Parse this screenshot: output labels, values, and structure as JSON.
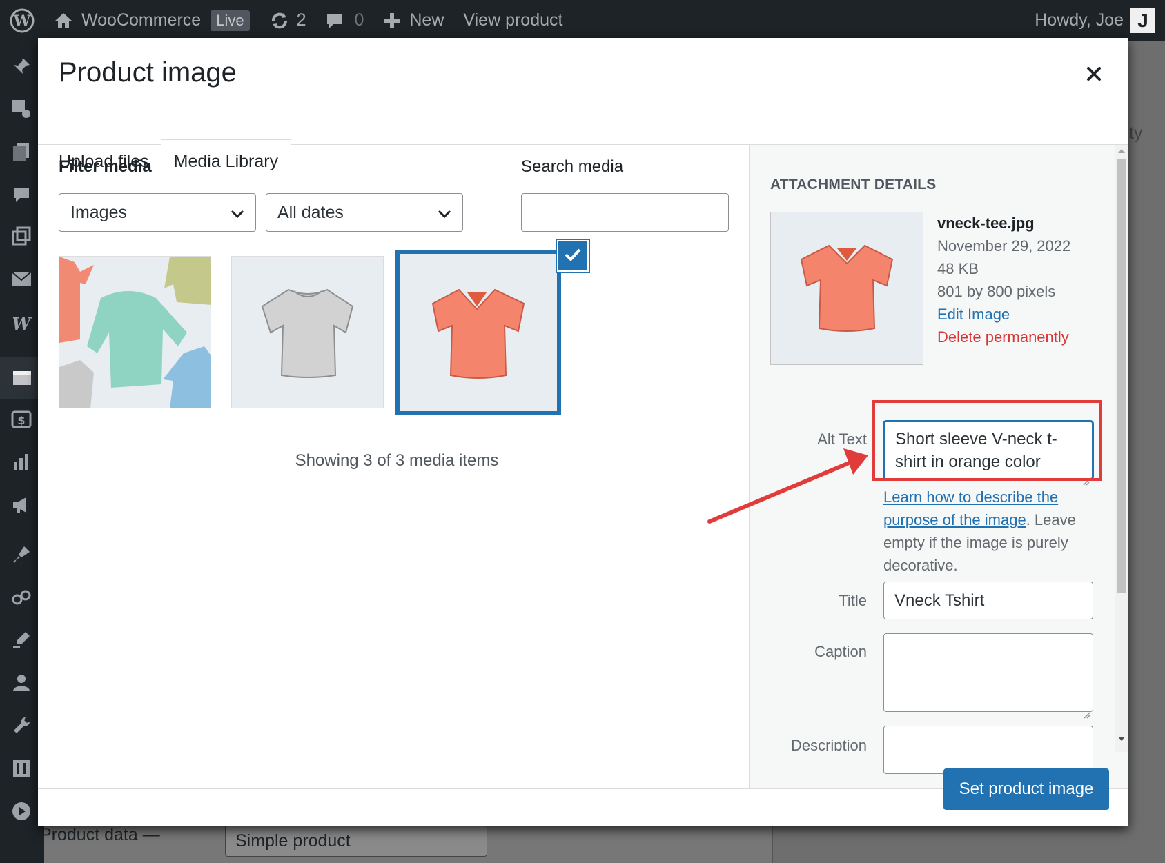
{
  "admin_bar": {
    "site_name": "WooCommerce",
    "live_badge": "Live",
    "updates_count": "2",
    "comments_count": "0",
    "new_label": "New",
    "view_product_label": "View product",
    "greeting": "Howdy, Joe",
    "avatar_letter": "J"
  },
  "background": {
    "product_data_label": "Product data —",
    "product_type_value": "Simple product",
    "right_text": "vity"
  },
  "modal": {
    "title": "Product image",
    "tabs": [
      {
        "label": "Upload files",
        "active": false
      },
      {
        "label": "Media Library",
        "active": true
      }
    ],
    "filter_label": "Filter media",
    "type_filter_value": "Images",
    "date_filter_value": "All dates",
    "search_label": "Search media",
    "search_value": "",
    "media_items": [
      {
        "name": "long-sleeve-tees",
        "selected": false
      },
      {
        "name": "gray-tshirt",
        "selected": false
      },
      {
        "name": "vneck-tee",
        "selected": true
      }
    ],
    "count_text": "Showing 3 of 3 media items",
    "primary_button": "Set product image"
  },
  "attachment": {
    "heading": "ATTACHMENT DETAILS",
    "filename": "vneck-tee.jpg",
    "date": "November 29, 2022",
    "size": "48 KB",
    "dimensions": "801 by 800 pixels",
    "edit_link": "Edit Image",
    "delete_link": "Delete permanently",
    "alt_label": "Alt Text",
    "alt_value": "Short sleeve V-neck t-shirt in orange color",
    "help_link": "Learn how to describe the purpose of the image",
    "help_rest": ". Leave empty if the image is purely decorative.",
    "title_label": "Title",
    "title_value": "Vneck Tshirt",
    "caption_label": "Caption",
    "caption_value": "",
    "description_label": "Description"
  },
  "colors": {
    "accent": "#2271b1",
    "annotation": "#e03c3c",
    "danger": "#d63638",
    "admin_bar": "#1d2327"
  }
}
